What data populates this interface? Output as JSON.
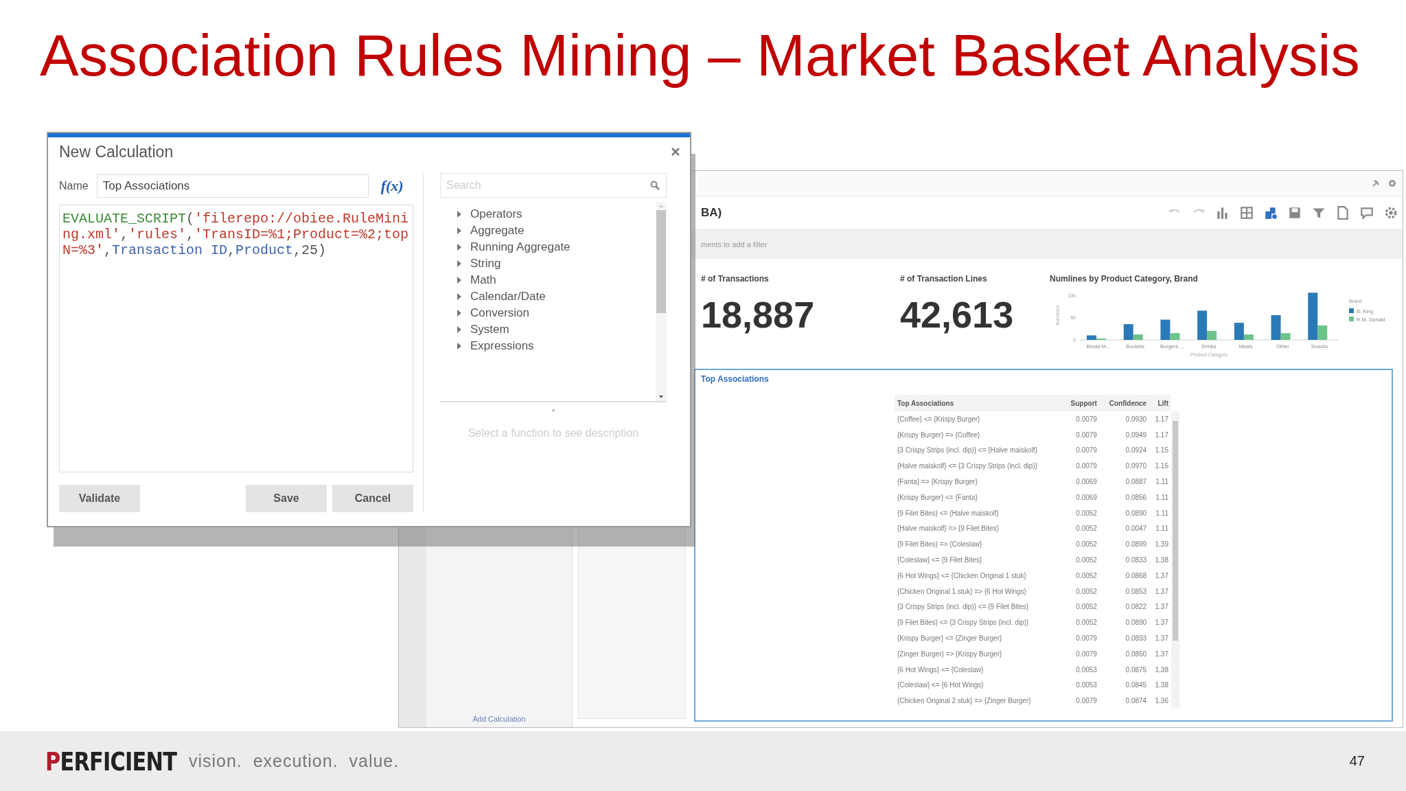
{
  "slide_title": "Association Rules Mining – Market Basket Analysis",
  "dashboard": {
    "title": "BA)",
    "filter_hint": "ments to add a filter",
    "toolbar": [
      {
        "kind": "undo",
        "selected": false
      },
      {
        "kind": "redo",
        "selected": false
      },
      {
        "kind": "chart",
        "selected": false
      },
      {
        "kind": "grid",
        "selected": false
      },
      {
        "kind": "pieces",
        "selected": true
      },
      {
        "kind": "save",
        "selected": false
      },
      {
        "kind": "filter",
        "selected": false
      },
      {
        "kind": "page",
        "selected": false
      },
      {
        "kind": "comment",
        "selected": false
      },
      {
        "kind": "gear",
        "selected": false
      }
    ],
    "add_calculation": "Add Calculation",
    "kpis": [
      {
        "label": "# of Transactions",
        "value": "18,887"
      },
      {
        "label": "# of Transaction Lines",
        "value": "42,613"
      }
    ],
    "chart": {
      "title": "Numlines by Product Category, Brand",
      "chart_data": {
        "type": "bar",
        "xlabel": "Product Category",
        "ylabel": "Numlines",
        "categories": [
          "Bread M...",
          "Buckets",
          "Burgers ...",
          "Drinks",
          "Meals",
          "Other",
          "Snacks"
        ],
        "yticks": [
          0,
          50,
          100
        ],
        "ylim": [
          0,
          110
        ],
        "legend": {
          "title": "Brand"
        },
        "series": [
          {
            "name": "B. King",
            "color": "#2a7ab8",
            "values": [
              10,
              35,
              45,
              65,
              38,
              55,
              105
            ]
          },
          {
            "name": "R.M. Donald",
            "color": "#6cc38a",
            "values": [
              3,
              12,
              15,
              20,
              12,
              15,
              32
            ]
          }
        ]
      }
    },
    "associations": {
      "title": "Top Associations",
      "columns": [
        "Top Associations",
        "Support",
        "Confidence",
        "Lift"
      ],
      "rows": [
        [
          "{Coffee} <= {Krispy Burger}",
          "0.0079",
          "0.0930",
          "1.17"
        ],
        [
          "{Krispy Burger} => {Coffee}",
          "0.0079",
          "0.0949",
          "1.17"
        ],
        [
          "{3 Crispy Strips (incl. dip)} <= {Halve maiskolf}",
          "0.0079",
          "0.0924",
          "1.15"
        ],
        [
          "{Halve maiskolf} <= {3 Crispy Strips (incl. dip)}",
          "0.0079",
          "0.0970",
          "1.15"
        ],
        [
          "{Fanta} => {Krispy Burger}",
          "0.0069",
          "0.0887",
          "1.11"
        ],
        [
          "{Krispy Burger} <= {Fanta}",
          "0.0069",
          "0.0856",
          "1.11"
        ],
        [
          "{9 Filet Bites} <= {Halve maiskolf}",
          "0.0052",
          "0.0890",
          "1.11"
        ],
        [
          "{Halve maiskolf} => {9 Filet Bites}",
          "0.0052",
          "0.0047",
          "1.11"
        ],
        [
          "{9 Filet Bites} => {Coleslaw}",
          "0.0052",
          "0.0899",
          "1.39"
        ],
        [
          "{Coleslaw} <= {9 Filet Bites}",
          "0.0052",
          "0.0833",
          "1.38"
        ],
        [
          "{6 Hot Wings} <= {Chicken Original 1 stuk}",
          "0.0052",
          "0.0868",
          "1.37"
        ],
        [
          "{Chicken Original 1 stuk} => {6 Hot Wings}",
          "0.0052",
          "0.0853",
          "1.37"
        ],
        [
          "{3 Crispy Strips (incl. dip)} <= {9 Filet Bites}",
          "0.0052",
          "0.0822",
          "1.37"
        ],
        [
          "{9 Filet Bites} <= {3 Crispy Strips (incl. dip)}",
          "0.0052",
          "0.0890",
          "1.37"
        ],
        [
          "{Krispy Burger} <= {Zinger Burger}",
          "0.0079",
          "0.0893",
          "1.37"
        ],
        [
          "{Zinger Burger} => {Krispy Burger}",
          "0.0079",
          "0.0850",
          "1.37"
        ],
        [
          "{6 Hot Wings} <= {Coleslaw}",
          "0.0053",
          "0.0875",
          "1.38"
        ],
        [
          "{Coleslaw} <= {6 Hot Wings}",
          "0.0053",
          "0.0845",
          "1.38"
        ],
        [
          "{Chicken Original 2 stuk} => {Zinger Burger}",
          "0.0079",
          "0.0874",
          "1.36"
        ]
      ]
    }
  },
  "dialog": {
    "title": "New Calculation",
    "name_label": "Name",
    "name_value": "Top Associations",
    "fx_label": "f(x)",
    "code": [
      {
        "kind": "function",
        "text": "EVALUATE_SCRIPT"
      },
      {
        "kind": "plain",
        "text": "("
      },
      {
        "kind": "string",
        "text": "'filerepo://obiee.RuleMining.xml'"
      },
      {
        "kind": "plain",
        "text": ","
      },
      {
        "kind": "string",
        "text": "'rules'"
      },
      {
        "kind": "plain",
        "text": ","
      },
      {
        "kind": "string",
        "text": "'TransID=%1;Product=%2;topN=%3'"
      },
      {
        "kind": "plain",
        "text": ","
      },
      {
        "kind": "column",
        "text": "Transaction ID"
      },
      {
        "kind": "plain",
        "text": ","
      },
      {
        "kind": "column",
        "text": "Product"
      },
      {
        "kind": "plain",
        "text": ",25)"
      }
    ],
    "buttons": [
      "Validate",
      "Save",
      "Cancel"
    ],
    "search_placeholder": "Search",
    "functions": [
      "Operators",
      "Aggregate",
      "Running Aggregate",
      "String",
      "Math",
      "Calendar/Date",
      "Conversion",
      "System",
      "Expressions"
    ],
    "description_hint": "Select a function to see description"
  },
  "footer": {
    "logo": "PERFICIENT",
    "tagline": "vision.  execution.  value.",
    "page_number": "47"
  }
}
